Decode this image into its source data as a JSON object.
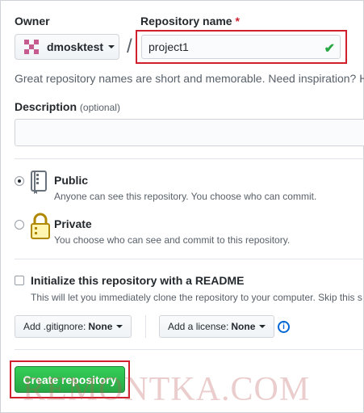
{
  "owner": {
    "label": "Owner",
    "value": "dmosktest"
  },
  "repo": {
    "label": "Repository name",
    "required_mark": "*",
    "value": "project1"
  },
  "hint": "Great repository names are short and memorable. Need inspiration? H",
  "description": {
    "label": "Description",
    "optional": "(optional)",
    "value": ""
  },
  "visibility": {
    "options": [
      {
        "title": "Public",
        "note": "Anyone can see this repository. You choose who can commit.",
        "checked": true,
        "icon": "repo-book-icon"
      },
      {
        "title": "Private",
        "note": "You choose who can see and commit to this repository.",
        "checked": false,
        "icon": "lock-icon"
      }
    ]
  },
  "readme": {
    "label": "Initialize this repository with a README",
    "note": "This will let you immediately clone the repository to your computer. Skip this s",
    "checked": false
  },
  "gitignore": {
    "label": "Add .gitignore:",
    "value": "None"
  },
  "license": {
    "label": "Add a license:",
    "value": "None"
  },
  "create_button": "Create repository",
  "watermark": "REMONTKA.COM",
  "colors": {
    "accent_green": "#28a745",
    "highlight_red": "#d0202e",
    "link_blue": "#0366d6"
  }
}
